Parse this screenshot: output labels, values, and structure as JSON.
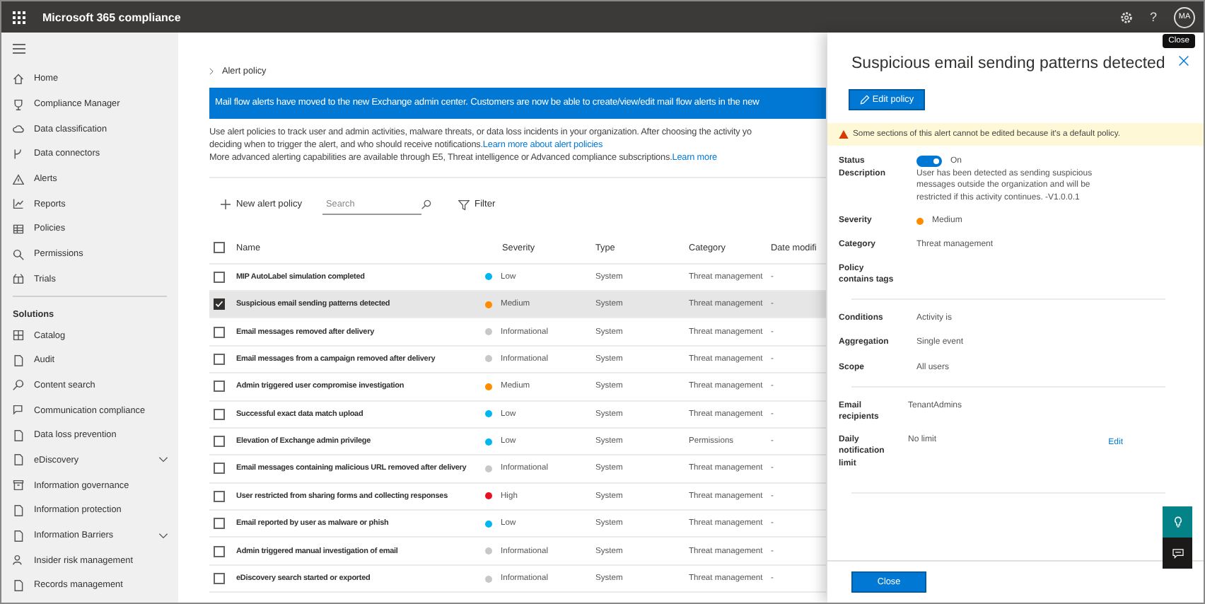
{
  "top_bar": {
    "app_title": "Microsoft 365 compliance",
    "help": "?",
    "avatar_initials": "MA"
  },
  "sidebar": {
    "items": [
      {
        "label": "Home"
      },
      {
        "label": "Compliance Manager"
      },
      {
        "label": "Data classification"
      },
      {
        "label": "Data connectors"
      },
      {
        "label": "Alerts"
      },
      {
        "label": "Reports"
      },
      {
        "label": "Policies"
      },
      {
        "label": "Permissions"
      },
      {
        "label": "Trials"
      }
    ],
    "section_title": "Solutions",
    "solution_items": [
      {
        "label": "Catalog",
        "expandable": false
      },
      {
        "label": "Audit",
        "expandable": false
      },
      {
        "label": "Content search",
        "expandable": false
      },
      {
        "label": "Communication compliance",
        "expandable": false
      },
      {
        "label": "Data loss prevention",
        "expandable": false
      },
      {
        "label": "eDiscovery",
        "expandable": true
      },
      {
        "label": "Information governance",
        "expandable": false
      },
      {
        "label": "Information protection",
        "expandable": false
      },
      {
        "label": "Information Barriers",
        "expandable": true
      },
      {
        "label": "Insider risk management",
        "expandable": false
      },
      {
        "label": "Records management",
        "expandable": false
      }
    ]
  },
  "breadcrumb": "Alert policy",
  "banner": "Mail flow alerts have moved to the new Exchange admin center. Customers are now be able to create/view/edit mail flow alerts in the new",
  "description": [
    {
      "text": "Use alert policies to track user and admin activities, malware threats, or data loss incidents in your organization. After choosing the activity yo"
    },
    {
      "text": "deciding when to trigger the alert, and who should receive notifications.",
      "link": "Learn more about alert policies"
    },
    {
      "text": "More advanced alerting capabilities are available through E5, Threat intelligence or Advanced compliance subscriptions.",
      "link": "Learn more"
    }
  ],
  "toolbar": {
    "new_button": "New alert policy",
    "search": {
      "placeholder": "Search"
    },
    "filter": "Filter"
  },
  "table": {
    "select_all_checked": false,
    "columns": [
      "Name",
      "Severity",
      "Type",
      "Category",
      "Date modifi"
    ],
    "rows": [
      {
        "name": "MIP AutoLabel simulation completed",
        "severity": "Low",
        "color": "#00b7f0",
        "type": "System",
        "category": "Threat management",
        "date": "-",
        "selected": false
      },
      {
        "name": "Suspicious email sending patterns detected",
        "severity": "Medium",
        "color": "#ff8c00",
        "type": "System",
        "category": "Threat management",
        "date": "-",
        "selected": true
      },
      {
        "name": "Email messages removed after delivery",
        "severity": "Informational",
        "color": "#c8c8c8",
        "type": "System",
        "category": "Threat management",
        "date": "-",
        "selected": false
      },
      {
        "name": "Email messages from a campaign removed after delivery",
        "severity": "Informational",
        "color": "#c8c8c8",
        "type": "System",
        "category": "Threat management",
        "date": "-",
        "selected": false
      },
      {
        "name": "Admin triggered user compromise investigation",
        "severity": "Medium",
        "color": "#ff8c00",
        "type": "System",
        "category": "Threat management",
        "date": "-",
        "selected": false
      },
      {
        "name": "Successful exact data match upload",
        "severity": "Low",
        "color": "#00b7f0",
        "type": "System",
        "category": "Threat management",
        "date": "-",
        "selected": false
      },
      {
        "name": "Elevation of Exchange admin privilege",
        "severity": "Low",
        "color": "#00b7f0",
        "type": "System",
        "category": "Permissions",
        "date": "-",
        "selected": false
      },
      {
        "name": "Email messages containing malicious URL removed after delivery",
        "severity": "Informational",
        "color": "#c8c8c8",
        "type": "System",
        "category": "Threat management",
        "date": "-",
        "selected": false
      },
      {
        "name": "User restricted from sharing forms and collecting responses",
        "severity": "High",
        "color": "#e81123",
        "type": "System",
        "category": "Threat management",
        "date": "-",
        "selected": false
      },
      {
        "name": "Email reported by user as malware or phish",
        "severity": "Low",
        "color": "#00b7f0",
        "type": "System",
        "category": "Threat management",
        "date": "-",
        "selected": false
      },
      {
        "name": "Admin triggered manual investigation of email",
        "severity": "Informational",
        "color": "#c8c8c8",
        "type": "System",
        "category": "Threat management",
        "date": "-",
        "selected": false
      },
      {
        "name": "eDiscovery search started or exported",
        "severity": "Informational",
        "color": "#c8c8c8",
        "type": "System",
        "category": "Threat management",
        "date": "-",
        "selected": false
      }
    ]
  },
  "panel": {
    "title": "Suspicious email sending patterns detected",
    "close_tooltip": "Close",
    "edit_button": "Edit policy",
    "warning": "Some sections of this alert cannot be edited because it's a default policy.",
    "status": {
      "label": "Status",
      "on": true,
      "text": "On"
    },
    "description": {
      "label": "Description",
      "value": "User has been detected as sending suspicious messages outside the organization and will be restricted if this activity continues. -V1.0.0.1"
    },
    "severity": {
      "label": "Severity",
      "value": "Medium",
      "color": "#ff8c00"
    },
    "category": {
      "label": "Category",
      "value": "Threat management"
    },
    "tags": {
      "label": "Policy contains tags"
    },
    "conditions": [
      {
        "label": "Conditions",
        "value": "Activity is"
      },
      {
        "label": "Aggregation",
        "value": "Single event"
      },
      {
        "label": "Scope",
        "value": "All users"
      }
    ],
    "notifications": [
      {
        "label": "Email recipients",
        "value": "TenantAdmins"
      },
      {
        "label": "Daily notification limit",
        "value": "No limit"
      }
    ],
    "edit_link": "Edit",
    "close_button": "Close"
  }
}
